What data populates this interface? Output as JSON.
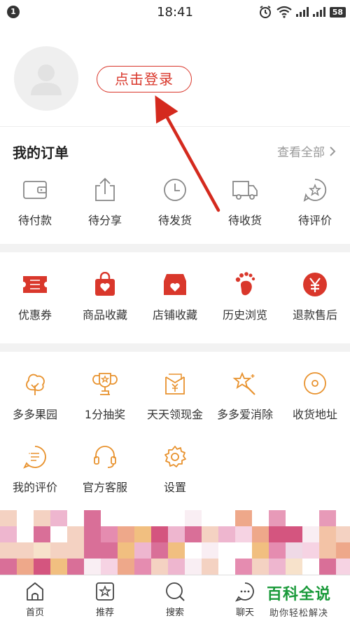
{
  "status_bar": {
    "notification_count": "1",
    "time": "18:41",
    "battery": "58"
  },
  "profile": {
    "login_label": "点击登录"
  },
  "orders": {
    "title": "我的订单",
    "view_all": "查看全部",
    "items": [
      {
        "label": "待付款",
        "icon": "wallet-icon"
      },
      {
        "label": "待分享",
        "icon": "share-icon"
      },
      {
        "label": "待发货",
        "icon": "clock-icon"
      },
      {
        "label": "待收货",
        "icon": "truck-icon"
      },
      {
        "label": "待评价",
        "icon": "star-bubble-icon"
      }
    ]
  },
  "services": {
    "items": [
      {
        "label": "优惠券",
        "icon": "coupon-icon"
      },
      {
        "label": "商品收藏",
        "icon": "bag-heart-icon"
      },
      {
        "label": "店铺收藏",
        "icon": "shop-heart-icon"
      },
      {
        "label": "历史浏览",
        "icon": "footprint-icon"
      },
      {
        "label": "退款售后",
        "icon": "yen-icon"
      }
    ]
  },
  "tools": {
    "items": [
      {
        "label": "多多果园",
        "icon": "tree-icon"
      },
      {
        "label": "1分抽奖",
        "icon": "trophy-icon"
      },
      {
        "label": "天天领现金",
        "icon": "cash-icon"
      },
      {
        "label": "多多爱消除",
        "icon": "magic-wand-icon"
      },
      {
        "label": "收货地址",
        "icon": "location-icon"
      },
      {
        "label": "我的评价",
        "icon": "comment-icon"
      },
      {
        "label": "官方客服",
        "icon": "headset-icon"
      },
      {
        "label": "设置",
        "icon": "settings-icon"
      }
    ]
  },
  "tabbar": {
    "items": [
      {
        "label": "首页",
        "icon": "home-icon"
      },
      {
        "label": "推荐",
        "icon": "recommend-icon"
      },
      {
        "label": "搜索",
        "icon": "search-icon"
      },
      {
        "label": "聊天",
        "icon": "chat-icon"
      }
    ]
  },
  "watermark": {
    "title": "百科全说",
    "subtitle": "助你轻松解决"
  },
  "colors": {
    "accent": "#d9372b",
    "tool_orange": "#e8922e",
    "watermark_green": "#1a9a3a"
  }
}
